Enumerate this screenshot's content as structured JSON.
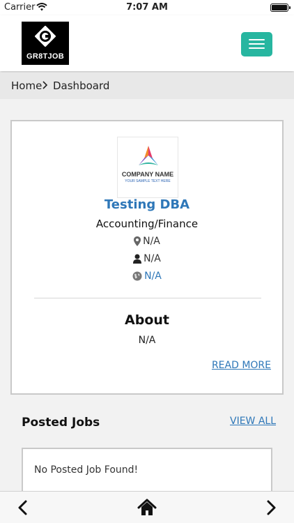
{
  "status_bar": {
    "carrier": "Carrier",
    "time": "7:07 AM"
  },
  "header": {
    "logo_text": "GR8TJOB",
    "logo_letter": "G",
    "menu_icon": "hamburger-menu-icon",
    "accent": "#27b6a0"
  },
  "breadcrumb": {
    "home": "Home",
    "current": "Dashboard"
  },
  "profile": {
    "logo_name": "COMPANY NAME",
    "logo_tagline": "YOUR SAMPLE TEXT HERE",
    "name": "Testing DBA",
    "industry": "Accounting/Finance",
    "location": "N/A",
    "contact": "N/A",
    "website": "N/A",
    "about_title": "About",
    "about_text": "N/A",
    "read_more": "READ MORE",
    "link_color": "#2e77b8"
  },
  "posted_jobs": {
    "title": "Posted Jobs",
    "view_all": "VIEW ALL",
    "empty_message": "No Posted Job Found!"
  },
  "bottom_nav": {
    "back_icon": "chevron-left-icon",
    "home_icon": "home-icon",
    "forward_icon": "chevron-right-icon"
  }
}
